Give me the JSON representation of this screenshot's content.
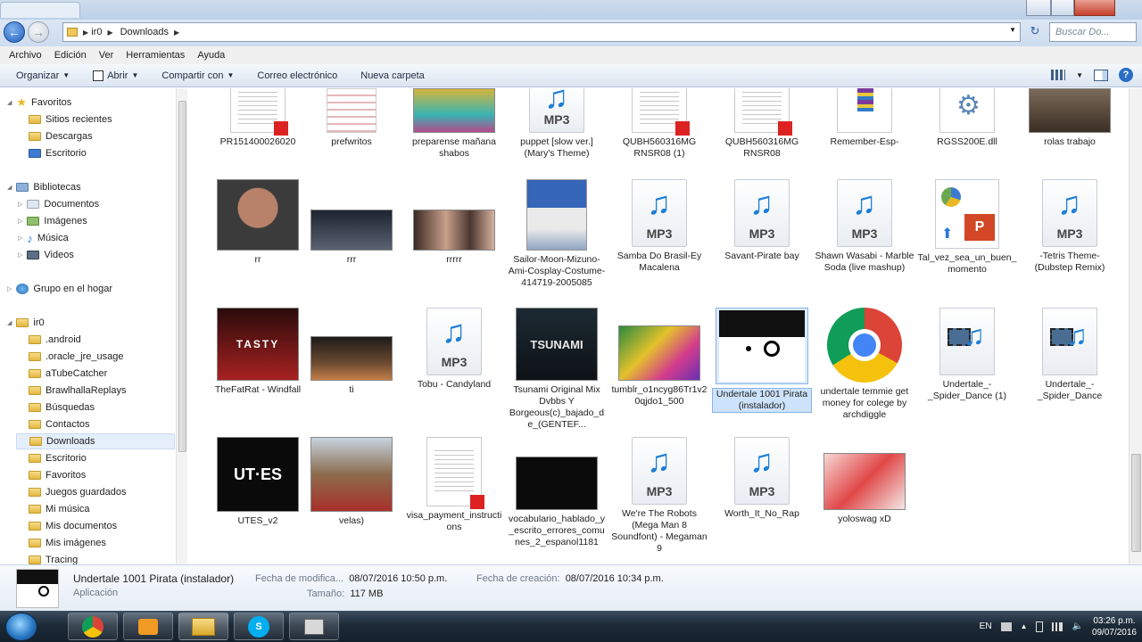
{
  "window": {
    "tab_label": "Descargas"
  },
  "address": {
    "crumbs": [
      "ir0",
      "Downloads"
    ],
    "search_placeholder": "Buscar Do..."
  },
  "menu": [
    "Archivo",
    "Edición",
    "Ver",
    "Herramientas",
    "Ayuda"
  ],
  "toolbar": {
    "organize": "Organizar",
    "open": "Abrir",
    "share": "Compartir con",
    "email": "Correo electrónico",
    "new_folder": "Nueva carpeta"
  },
  "nav": {
    "favorites": "Favoritos",
    "recent": "Sitios recientes",
    "downloads": "Descargas",
    "desktop": "Escritorio",
    "libraries": "Bibliotecas",
    "documents": "Documentos",
    "pictures": "Imágenes",
    "music": "Música",
    "videos": "Videos",
    "homegroup": "Grupo en el hogar",
    "user": "ir0",
    "folders": [
      ".android",
      ".oracle_jre_usage",
      "aTubeCatcher",
      "BrawlhallaReplays",
      "Búsquedas",
      "Contactos",
      "Downloads",
      "Escritorio",
      "Favoritos",
      "Juegos guardados",
      "Mi música",
      "Mis documentos",
      "Mis imágenes",
      "Tracing"
    ]
  },
  "files": {
    "r1": [
      "PR151400026020",
      "prefwritos",
      "preparense mañana shabos",
      "puppet [slow ver.] (Mary's Theme)",
      "QUBH560316MG RNSR08 (1)",
      "QUBH560316MG RNSR08",
      "Remember-Esp-",
      "RGSS200E.dll",
      "rolas trabajo"
    ],
    "r2": [
      "rr",
      "rrr",
      "rrrrr",
      "Sailor-Moon-Mizuno-Ami-Cosplay-Costume-414719-2005085",
      "Samba Do Brasil-Ey Macalena",
      "Savant-Pirate bay",
      "Shawn Wasabi - Marble Soda (live mashup)",
      "Tal_vez_sea_un_buen_momento",
      "-Tetris Theme- (Dubstep Remix)"
    ],
    "r3": [
      "TheFatRat - Windfall",
      "ti",
      "Tobu - Candyland",
      "Tsunami Original Mix Dvbbs Y Borgeous(c)_bajado_de_(GENTEF...",
      "tumblr_o1ncyg86Tr1v20qjdo1_500",
      "Undertale 1001 Pirata (instalador)",
      "undertale temmie get money for colege by archdiggle",
      "Undertale_-_Spider_Dance (1)",
      "Undertale_-_Spider_Dance"
    ],
    "r4": [
      "UTES_v2",
      "velas)",
      "visa_payment_instructions",
      "vocabulario_hablado_y_escrito_errores_comunes_2_espanol1181",
      "We're The Robots (Mega Man 8 Soundfont) - Megaman 9",
      "Worth_It_No_Rap",
      "yoloswag xD"
    ],
    "mp3_text": "MP3",
    "thumb_tasty": "TASTY",
    "thumb_tsunami": "TSUNAMI",
    "thumb_utes": "UT·ES"
  },
  "details": {
    "name": "Undertale 1001 Pirata (instalador)",
    "type": "Aplicación",
    "modified_label": "Fecha de modifica...",
    "modified_value": "08/07/2016 10:50 p.m.",
    "created_label": "Fecha de creación:",
    "created_value": "08/07/2016 10:34 p.m.",
    "size_label": "Tamaño:",
    "size_value": "117 MB"
  },
  "tray": {
    "lang": "EN",
    "time": "03:26 p.m.",
    "date": "09/07/2016"
  },
  "colors": {
    "accent": "#1d7fd8",
    "selection": "#cde3fb"
  }
}
